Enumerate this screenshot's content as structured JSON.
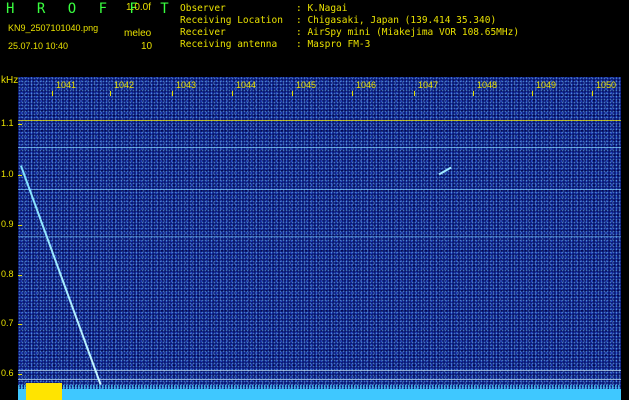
{
  "header": {
    "brand": "H R O F F T",
    "version": "1.0.0f",
    "filename": "KN9_2507101040.png",
    "timestamp": "25.07.10 10:40",
    "meleo_label": "meleo",
    "meleo_value": "10",
    "info": [
      {
        "key": "Observer",
        "value": ": K.Nagai"
      },
      {
        "key": "Receiving Location",
        "value": ": Chigasaki, Japan (139.414 35.340)"
      },
      {
        "key": "Receiver",
        "value": ": AirSpy mini (Miakejima VOR 108.65MHz)"
      },
      {
        "key": "Receiving antenna",
        "value": ": Maspro FM-3"
      }
    ]
  },
  "axes": {
    "unit": "kHz",
    "x_ticks": [
      "1041",
      "1042",
      "1043",
      "1044",
      "1045",
      "1046",
      "1047",
      "1048",
      "1049",
      "1050"
    ],
    "y_ticks": [
      "1.1",
      "1.0",
      "0.9",
      "0.8",
      "0.7",
      "0.6"
    ]
  },
  "colors": {
    "background": "#0a1a7a",
    "text": "#e8e000",
    "brand": "#39ff3f",
    "trail": "#7fe0ff",
    "noise_floor": "#3fc8ff",
    "carrier_line": "#e8e000"
  }
}
